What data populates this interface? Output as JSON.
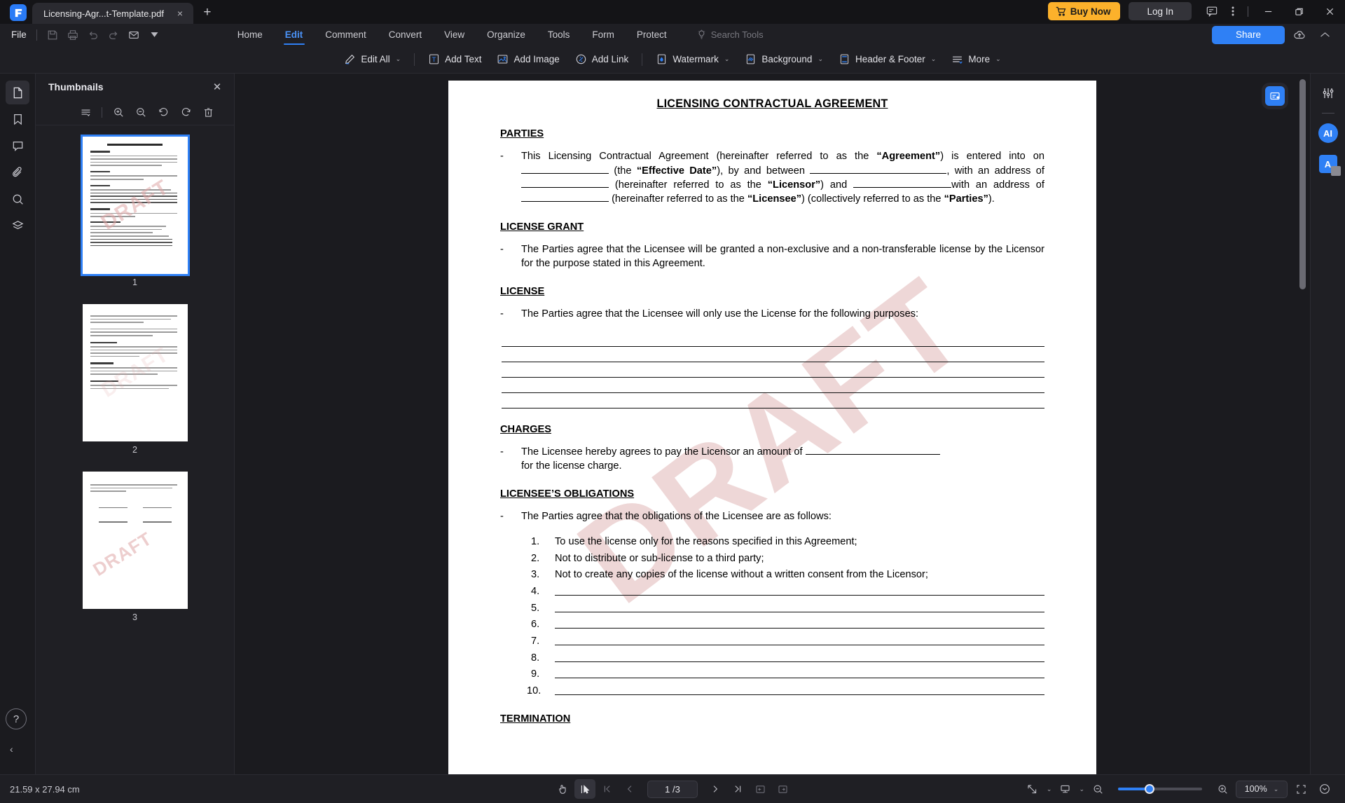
{
  "titlebar": {
    "tab_title": "Licensing-Agr...t-Template.pdf",
    "close_tab": "×",
    "new_tab": "+",
    "buy_now": "Buy Now",
    "log_in": "Log In",
    "minimize": "—",
    "restore": "❐",
    "close": "✕"
  },
  "menubar": {
    "file": "File",
    "tabs": [
      {
        "label": "Home",
        "active": false
      },
      {
        "label": "Edit",
        "active": true
      },
      {
        "label": "Comment",
        "active": false
      },
      {
        "label": "Convert",
        "active": false
      },
      {
        "label": "View",
        "active": false
      },
      {
        "label": "Organize",
        "active": false
      },
      {
        "label": "Tools",
        "active": false
      },
      {
        "label": "Form",
        "active": false
      },
      {
        "label": "Protect",
        "active": false
      }
    ],
    "search_tools_placeholder": "Search Tools",
    "share": "Share"
  },
  "ribbon": {
    "edit_all": "Edit All",
    "add_text": "Add Text",
    "add_image": "Add Image",
    "add_link": "Add Link",
    "watermark": "Watermark",
    "background": "Background",
    "header_footer": "Header & Footer",
    "more": "More",
    "caret": "⌄"
  },
  "sidebar": {
    "panel_title": "Thumbnails",
    "close": "✕",
    "pages": [
      {
        "number": "1",
        "selected": true
      },
      {
        "number": "2",
        "selected": false
      },
      {
        "number": "3",
        "selected": false
      }
    ],
    "watermark_text": "DRAFT"
  },
  "document": {
    "title": "LICENSING CONTRACTUAL AGREEMENT",
    "watermark": "DRAFT",
    "sections": {
      "parties_head": "PARTIES",
      "parties_body_1": "This Licensing Contractual Agreement (hereinafter referred to as the",
      "parties_agreement": "“Agreement”",
      "parties_body_2": "is entered into on",
      "parties_the": "(the",
      "parties_effective": "“Effective Date”",
      "parties_body_3": "), by and between",
      "parties_body_4": ", with an address of",
      "parties_body_5": "(hereinafter referred to as the",
      "parties_licensor": "“Licensor”",
      "parties_body_6": "and",
      "parties_body_7": "with an address of",
      "parties_body_8": "(hereinafter referred to as the",
      "parties_licensee": "“Licensee”",
      "parties_body_9": ") (collectively referred to as the",
      "parties_parties": "“Parties”",
      "parties_body_10": ").",
      "license_grant_head": "LICENSE GRANT",
      "license_grant_body": "The Parties agree that the Licensee will be granted a non-exclusive and a non-transferable license by the Licensor for the purpose stated in this Agreement.",
      "license_head": "LICENSE",
      "license_body": "The Parties agree that the Licensee will only use the License for the following purposes:",
      "license_blank_lines": 5,
      "charges_head": "CHARGES",
      "charges_body_1": "The Licensee hereby agrees to pay the Licensor an amount of",
      "charges_body_2": "for the license charge.",
      "obligations_head": "LICENSEE’S OBLIGATIONS",
      "obligations_body": "The Parties agree that the obligations of the Licensee are as follows:",
      "obligations_items": [
        {
          "n": "1.",
          "text": "To use the license only for the reasons specified in this Agreement;"
        },
        {
          "n": "2.",
          "text": "Not to distribute or sub-license to a third party;"
        },
        {
          "n": "3.",
          "text": "Not to create any copies of the license without a written consent from the Licensor;"
        },
        {
          "n": "4.",
          "text": ""
        },
        {
          "n": "5.",
          "text": ""
        },
        {
          "n": "6.",
          "text": ""
        },
        {
          "n": "7.",
          "text": ""
        },
        {
          "n": "8.",
          "text": ""
        },
        {
          "n": "9.",
          "text": ""
        },
        {
          "n": "10.",
          "text": ""
        }
      ],
      "termination_head": "TERMINATION"
    }
  },
  "statusbar": {
    "page_size": "21.59 x 27.94 cm",
    "page_indicator": "1 /3",
    "zoom_level": "100%",
    "caret": "⌄"
  },
  "colors": {
    "accent": "#2f80f5",
    "buy_now": "#fcb12b",
    "chrome_dark": "#1f1f24",
    "titlebar": "#141417",
    "watermark": "#e8c8c8"
  }
}
